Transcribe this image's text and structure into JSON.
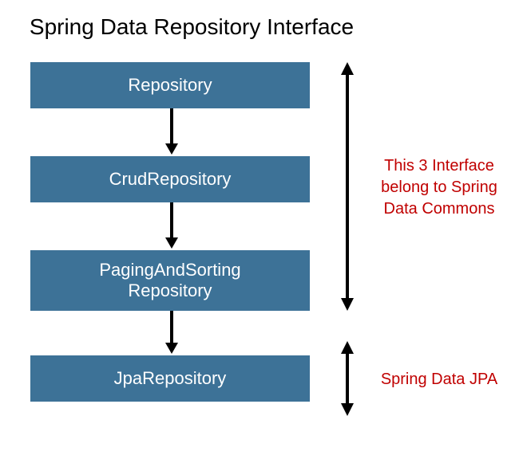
{
  "title": "Spring Data Repository Interface",
  "boxes": {
    "repository": "Repository",
    "crud": "CrudRepository",
    "paging_line1": "PagingAndSorting",
    "paging_line2": "Repository",
    "jpa": "JpaRepository"
  },
  "annotations": {
    "commons_line1": "This 3 Interface",
    "commons_line2": "belong to Spring",
    "commons_line3": "Data Commons",
    "jpa": "Spring Data JPA"
  },
  "colors": {
    "box_bg": "#3d7297",
    "annotation_color": "#c00000"
  }
}
